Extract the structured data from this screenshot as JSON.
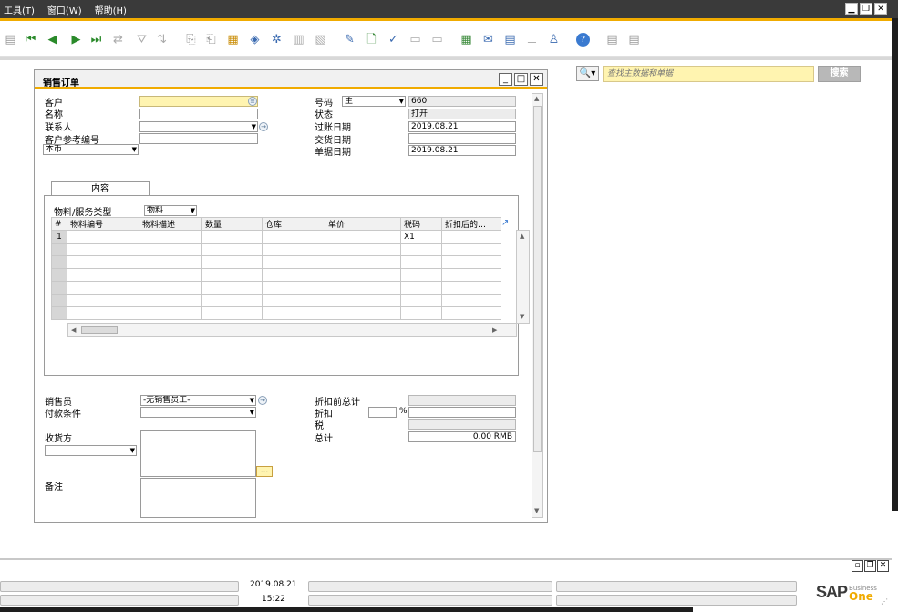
{
  "menubar": {
    "items": [
      "工具(T)",
      "窗口(W)",
      "帮助(H)"
    ],
    "win_min": "▁",
    "win_restore": "❐",
    "win_close": "✕"
  },
  "search": {
    "placeholder": "查找主数据和单据",
    "button": "搜索",
    "icon_glyph": "🔍▾"
  },
  "form": {
    "title": "销售订单",
    "win_min": "_",
    "win_max": "□",
    "win_close": "✕",
    "fields": {
      "customer_label": "客户",
      "name_label": "名称",
      "contact_label": "联系人",
      "cust_ref_label": "客户参考编号",
      "currency_value": "本币",
      "number_label": "号码",
      "number_series": "主",
      "number_value": "660",
      "status_label": "状态",
      "status_value": "打开",
      "posting_date_label": "过账日期",
      "posting_date_value": "2019.08.21",
      "delivery_date_label": "交货日期",
      "doc_date_label": "单据日期",
      "doc_date_value": "2019.08.21"
    },
    "tab_label": "内容",
    "item_type_label": "物料/服务类型",
    "item_type_value": "物料",
    "grid": {
      "columns": [
        "#",
        "物料编号",
        "物料描述",
        "数量",
        "仓库",
        "单价",
        "税码",
        "折扣后的…"
      ],
      "rows": [
        [
          "1",
          "",
          "",
          "",
          "",
          "",
          "X1",
          ""
        ]
      ]
    },
    "footer": {
      "sales_employee_label": "销售员",
      "sales_employee_value": "-无销售员工-",
      "payment_terms_label": "付款条件",
      "ship_to_label": "收货方",
      "remarks_label": "备注",
      "total_before_discount_label": "折扣前总计",
      "discount_label": "折扣",
      "percent_sign": "%",
      "tax_label": "税",
      "total_label": "总计",
      "total_value": "0.00 RMB",
      "ellipsis": "..."
    }
  },
  "status_bar": {
    "date": "2019.08.21",
    "time": "15:22"
  },
  "brand": {
    "logo_main": "SAP",
    "logo_business": "Business",
    "logo_one": "One"
  }
}
